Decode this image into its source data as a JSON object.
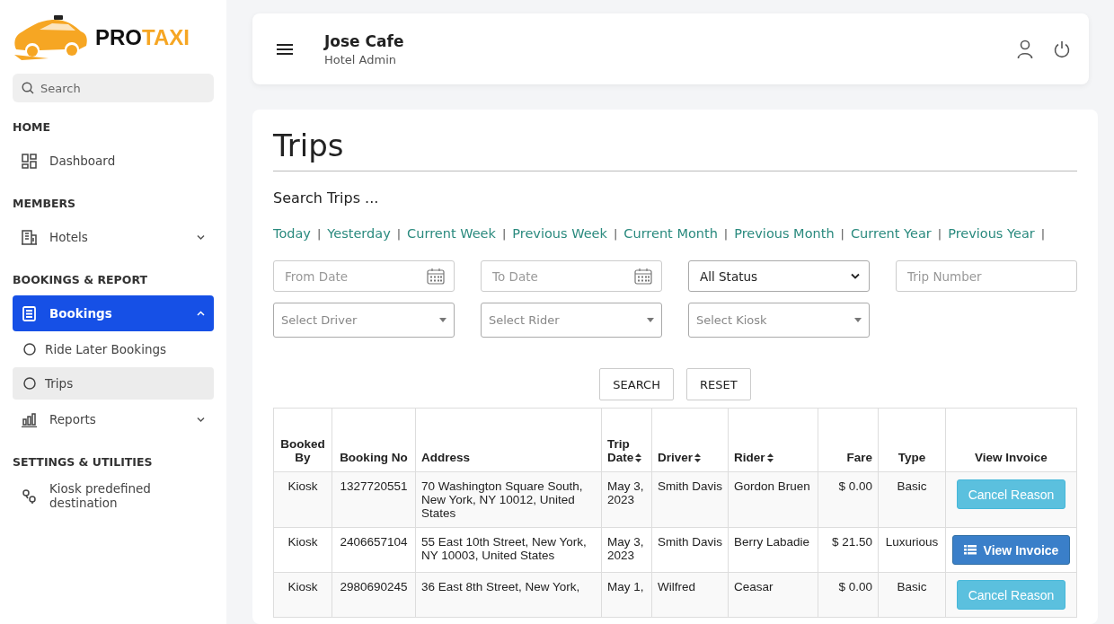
{
  "brand": {
    "part_1": "PRO",
    "part_2": "TAXI"
  },
  "sidebar": {
    "search": {
      "placeholder": "Search"
    },
    "items": [
      {
        "kind": "section",
        "label": "HOME"
      },
      {
        "kind": "item",
        "label": "Dashboard",
        "selected": false
      },
      {
        "kind": "section",
        "label": "MEMBERS"
      },
      {
        "kind": "item",
        "label": "Hotels",
        "selected": false,
        "expanded": false
      },
      {
        "kind": "section",
        "label": "BOOKINGS & REPORT"
      },
      {
        "kind": "item",
        "label": "Bookings",
        "selected": true,
        "expanded": true,
        "children": [
          {
            "label": "Ride Later Bookings",
            "selected": false
          },
          {
            "label": "Trips",
            "selected": true
          }
        ]
      },
      {
        "kind": "item",
        "label": "Reports",
        "selected": false,
        "expanded": false
      },
      {
        "kind": "section",
        "label": "SETTINGS & UTILITIES"
      },
      {
        "kind": "item",
        "label": "Kiosk predefined destination",
        "selected": false
      }
    ]
  },
  "header": {
    "title": "Jose Cafe",
    "subtitle": "Hotel Admin"
  },
  "page": {
    "title": "Trips",
    "search_heading": "Search Trips ...",
    "quick_ranges": [
      {
        "label": "Today",
        "separator": "|"
      },
      {
        "label": "Yesterday",
        "separator": "|"
      },
      {
        "label": "Current Week",
        "separator": "|"
      },
      {
        "label": "Previous Week",
        "separator": "|"
      },
      {
        "label": "Current Month",
        "separator": "|"
      },
      {
        "label": "Previous Month",
        "separator": "|"
      },
      {
        "label": "Current Year",
        "separator": "|"
      },
      {
        "label": "Previous Year",
        "separator": "|"
      }
    ],
    "filters": [
      {
        "kind": "date",
        "placeholder": "From Date"
      },
      {
        "kind": "date",
        "placeholder": "To Date"
      },
      {
        "kind": "select",
        "value": "All Status"
      },
      {
        "kind": "text",
        "placeholder": "Trip Number"
      },
      {
        "kind": "combo",
        "placeholder": "Select Driver"
      },
      {
        "kind": "combo",
        "placeholder": "Select Rider"
      },
      {
        "kind": "combo",
        "placeholder": "Select Kiosk"
      }
    ],
    "buttons": [
      "SEARCH",
      "RESET"
    ]
  },
  "table": {
    "columns": [
      {
        "label": "Booked By",
        "sortable": false
      },
      {
        "label": "Booking No",
        "sortable": false
      },
      {
        "label": "Address",
        "sortable": false
      },
      {
        "label": "Trip Date",
        "sortable": true
      },
      {
        "label": "Driver",
        "sortable": true
      },
      {
        "label": "Rider",
        "sortable": true
      },
      {
        "label": "Fare",
        "sortable": false
      },
      {
        "label": "Type",
        "sortable": false
      },
      {
        "label": "View Invoice",
        "sortable": false
      }
    ],
    "rows": [
      {
        "cells": [
          "Kiosk",
          "1327720551",
          "70 Washington Square South, New York, NY 10012, United States",
          "May 3, 2023",
          "Smith Davis",
          "Gordon Bruen",
          "$ 0.00",
          "Basic"
        ],
        "action": {
          "kind": "cancel",
          "label": "Cancel Reason"
        }
      },
      {
        "cells": [
          "Kiosk",
          "2406657104",
          "55 East 10th Street, New York, NY 10003, United States",
          "May 3, 2023",
          "Smith Davis",
          "Berry Labadie",
          "$ 21.50",
          "Luxurious"
        ],
        "action": {
          "kind": "invoice",
          "label": "View Invoice"
        }
      },
      {
        "cells": [
          "Kiosk",
          "2980690245",
          "36 East 8th Street, New York,",
          "May 1,",
          "Wilfred",
          "Ceasar",
          "$ 0.00",
          "Basic"
        ],
        "action": {
          "kind": "cancel",
          "label": "Cancel Reason"
        }
      }
    ]
  }
}
